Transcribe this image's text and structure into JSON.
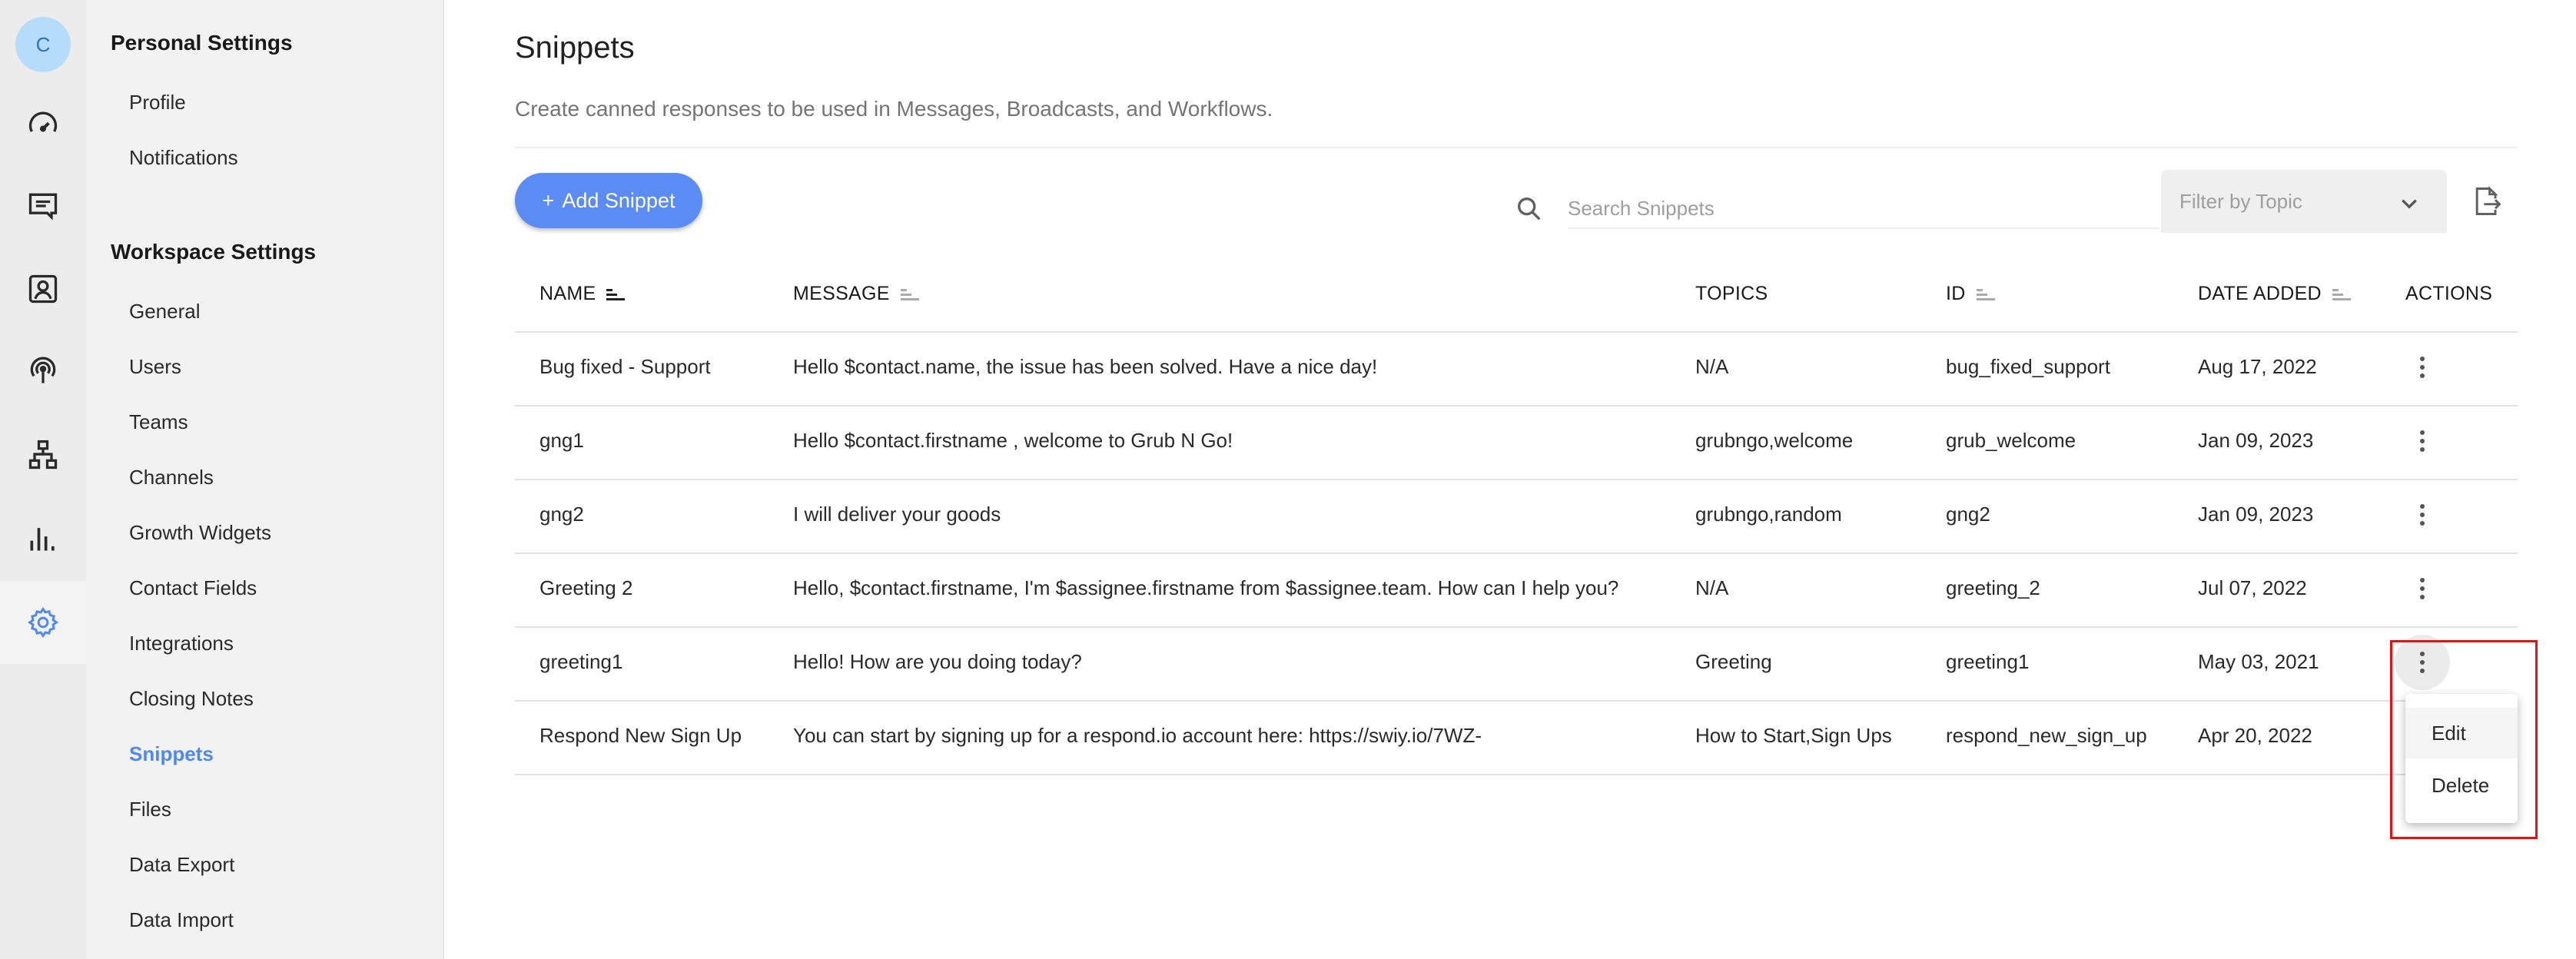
{
  "rail": {
    "avatar_initial": "C",
    "icons": [
      "dashboard-icon",
      "messages-icon",
      "contacts-icon",
      "broadcasts-icon",
      "workflows-icon",
      "reports-icon",
      "settings-icon"
    ],
    "active_icon": "settings-icon",
    "accent_color": "#4f88f0"
  },
  "settings_nav": {
    "personal_title": "Personal Settings",
    "personal_items": [
      "Profile",
      "Notifications"
    ],
    "workspace_title": "Workspace Settings",
    "workspace_items": [
      "General",
      "Users",
      "Teams",
      "Channels",
      "Growth Widgets",
      "Contact Fields",
      "Integrations",
      "Closing Notes",
      "Snippets",
      "Files",
      "Data Export",
      "Data Import"
    ],
    "active_item": "Snippets"
  },
  "page": {
    "title": "Snippets",
    "subtitle": "Create canned responses to be used in Messages, Broadcasts, and Workflows."
  },
  "toolbar": {
    "add_button_icon": "+",
    "add_button_label": "Add Snippet",
    "search_placeholder": "Search Snippets",
    "search_value": "",
    "filter_placeholder": "Filter by Topic",
    "export_icon": "export-file-icon"
  },
  "table": {
    "columns": [
      {
        "label": "NAME",
        "sortable": true,
        "sort_active": true
      },
      {
        "label": "MESSAGE",
        "sortable": true,
        "sort_active": false
      },
      {
        "label": "TOPICS",
        "sortable": false
      },
      {
        "label": "ID",
        "sortable": true,
        "sort_active": false
      },
      {
        "label": "DATE ADDED",
        "sortable": true,
        "sort_active": false
      },
      {
        "label": "ACTIONS",
        "sortable": false
      }
    ],
    "rows": [
      {
        "name": "Bug fixed - Support",
        "message": "Hello $contact.name, the issue has been solved. Have a nice day!",
        "topics": "N/A",
        "id": "bug_fixed_support",
        "date_added": "Aug 17, 2022"
      },
      {
        "name": "gng1",
        "message": "Hello $contact.firstname , welcome to Grub N Go!",
        "topics": "grubngo,welcome",
        "id": "grub_welcome",
        "date_added": "Jan 09, 2023"
      },
      {
        "name": "gng2",
        "message": "I will deliver your goods",
        "topics": "grubngo,random",
        "id": "gng2",
        "date_added": "Jan 09, 2023"
      },
      {
        "name": "Greeting 2",
        "message": "Hello, $contact.firstname, I'm $assignee.firstname from $assignee.team. How can I help you?",
        "topics": "N/A",
        "id": "greeting_2",
        "date_added": "Jul 07, 2022"
      },
      {
        "name": "greeting1",
        "message": "Hello! How are you doing today?",
        "topics": "Greeting",
        "id": "greeting1",
        "date_added": "May 03, 2021"
      },
      {
        "name": "Respond New Sign Up",
        "message": "You can start by signing up for a respond.io account here: https://swiy.io/7WZ-",
        "topics": "How to Start,Sign Ups",
        "id": "respond_new_sign_up",
        "date_added": "Apr 20, 2022"
      }
    ]
  },
  "actions_menu": {
    "open_for_row": 4,
    "items": [
      "Edit",
      "Delete"
    ],
    "hovered_item": "Edit",
    "highlight_color": "#e81010"
  }
}
